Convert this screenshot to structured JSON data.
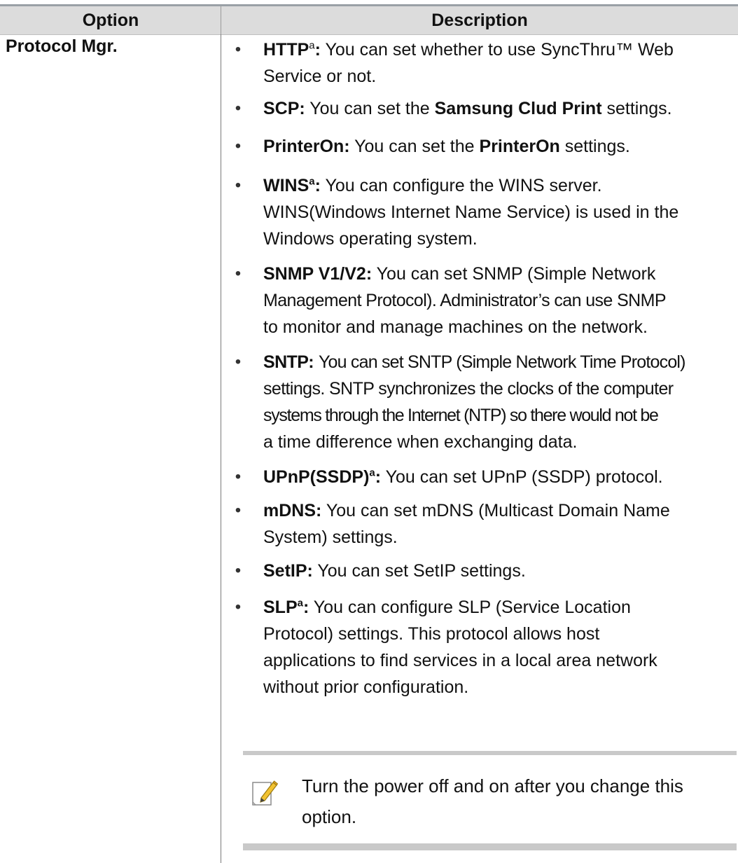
{
  "header": {
    "option": "Option",
    "description": "Description"
  },
  "row": {
    "option": "Protocol Mgr.",
    "items": [
      {
        "term": "HTTP",
        "sup": "a",
        "colon": ":",
        "lines": [
          "You can set whether to use SyncThru™ Web",
          "Service or not."
        ]
      },
      {
        "term": "SCP:",
        "sup": "",
        "colon": "",
        "pre": "You can set the ",
        "bold2": "Samsung Clud Print",
        "post": " settings."
      },
      {
        "term": "PrinterOn:",
        "sup": "",
        "colon": "",
        "pre": "You can set the ",
        "bold2": "PrinterOn",
        "post": " settings."
      },
      {
        "term": "WINS",
        "sup": "a",
        "colon": ":",
        "lines": [
          "You can configure the WINS server.",
          "WINS(Windows Internet Name Service) is used in the",
          "Windows operating system."
        ]
      },
      {
        "term": "SNMP V1/V2:",
        "sup": "",
        "colon": "",
        "lines": [
          "You can set SNMP (Simple Network",
          "Management Protocol). Administrator’s can use SNMP",
          "to monitor and manage machines on the network."
        ]
      },
      {
        "term": "SNTP:",
        "sup": "",
        "colon": "",
        "lines": [
          "You can set SNTP (Simple Network Time Protocol)",
          "settings. SNTP synchronizes the clocks of the computer",
          "systems through the Internet (NTP) so there would not be",
          "a time difference when exchanging data."
        ]
      },
      {
        "term": "UPnP(SSDP)",
        "sup": "a",
        "colon": ":",
        "lines": [
          "You can set UPnP (SSDP) protocol."
        ]
      },
      {
        "term": "mDNS:",
        "sup": "",
        "colon": "",
        "lines": [
          "You can set mDNS (Multicast Domain Name",
          "System) settings."
        ]
      },
      {
        "term": "SetIP:",
        "sup": "",
        "colon": "",
        "lines": [
          "You can set SetIP settings."
        ]
      },
      {
        "term": "SLP",
        "sup": "a",
        "colon": ":",
        "lines": [
          "You can configure SLP (Service Location",
          "Protocol) settings. This protocol allows host",
          "applications to find services in a local area network",
          "without prior configuration."
        ]
      }
    ],
    "note": {
      "icon": "note-pencil-icon",
      "lines": [
        "Turn the power off and on after you change this",
        "option."
      ]
    }
  }
}
